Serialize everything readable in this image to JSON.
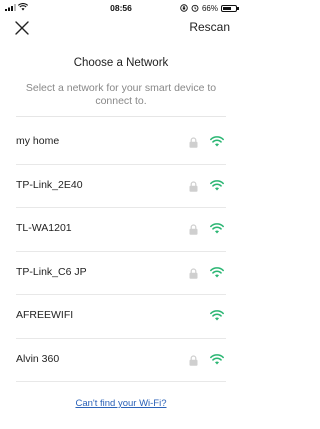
{
  "status_bar": {
    "time": "08:56",
    "battery": "66%",
    "battery_level": 0.66
  },
  "header": {
    "rescan_label": "Rescan"
  },
  "page": {
    "title": "Choose a Network",
    "subtitle": "Select a network for your smart device to connect to."
  },
  "networks": [
    {
      "name": "my home",
      "locked": true
    },
    {
      "name": "TP-Link_2E40",
      "locked": true
    },
    {
      "name": "TL-WA1201",
      "locked": true
    },
    {
      "name": "TP-Link_C6 JP",
      "locked": true
    },
    {
      "name": "AFREEWIFI",
      "locked": false
    },
    {
      "name": "Alvin 360",
      "locked": true
    }
  ],
  "footer": {
    "cant_find_label": "Can't find your Wi-Fi?"
  },
  "colors": {
    "wifi": "#2bb673",
    "lock": "#cfcfcf",
    "link": "#2b62b8"
  }
}
